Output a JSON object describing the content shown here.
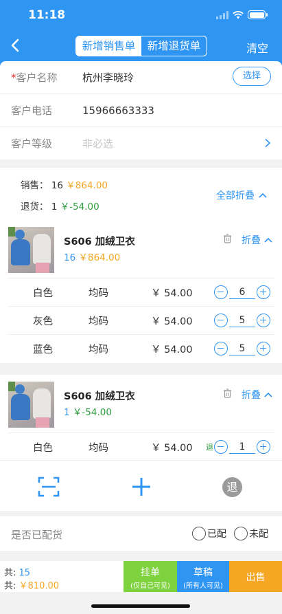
{
  "status_bar": {
    "time": "11:18"
  },
  "header": {
    "tabs": [
      {
        "label": "新增销售单",
        "active": true
      },
      {
        "label": "新增退货单",
        "active": false
      }
    ],
    "clear_label": "清空",
    "accent_color": "#2f95f3"
  },
  "form": {
    "customer_name": {
      "required_mark": "*",
      "label": "客户名称",
      "value": "杭州李晓玲",
      "select_label": "选择"
    },
    "customer_phone": {
      "label": "客户电话",
      "value": "15966663333"
    },
    "customer_level": {
      "label": "客户等级",
      "placeholder": "非必选"
    }
  },
  "summary": {
    "sale_label": "销售：",
    "sale_qty": "16",
    "sale_amount": "￥864.00",
    "return_label": "退货：",
    "return_qty": "1",
    "return_amount": "￥-54.00",
    "collapse_all_label": "全部折叠"
  },
  "products": [
    {
      "name": "S606  加绒卫衣",
      "qty": "16",
      "amount": "￥864.00",
      "fold_label": "折叠",
      "variants": [
        {
          "color": "白色",
          "size": "均码",
          "price": "￥ 54.00",
          "qty": "6"
        },
        {
          "color": "灰色",
          "size": "均码",
          "price": "￥ 54.00",
          "qty": "5"
        },
        {
          "color": "蓝色",
          "size": "均码",
          "price": "￥ 54.00",
          "qty": "5"
        }
      ]
    },
    {
      "name": "S606  加绒卫衣",
      "qty": "1",
      "amount": "￥-54.00",
      "fold_label": "折叠",
      "variants": [
        {
          "tag": "退",
          "color": "白色",
          "size": "均码",
          "price": "￥ 54.00",
          "qty": "1"
        }
      ]
    }
  ],
  "toolbar": {
    "return_label": "退"
  },
  "distribution": {
    "label": "是否已配货",
    "option_yes": "已配",
    "option_no": "未配"
  },
  "footer": {
    "total_label": "共:",
    "total_qty": "15",
    "total_amount": "￥810.00",
    "hang_label": "挂单",
    "hang_sub": "(仅自己可见)",
    "draft_label": "草稿",
    "draft_sub": "(所有人可见)",
    "sell_label": "出售"
  }
}
